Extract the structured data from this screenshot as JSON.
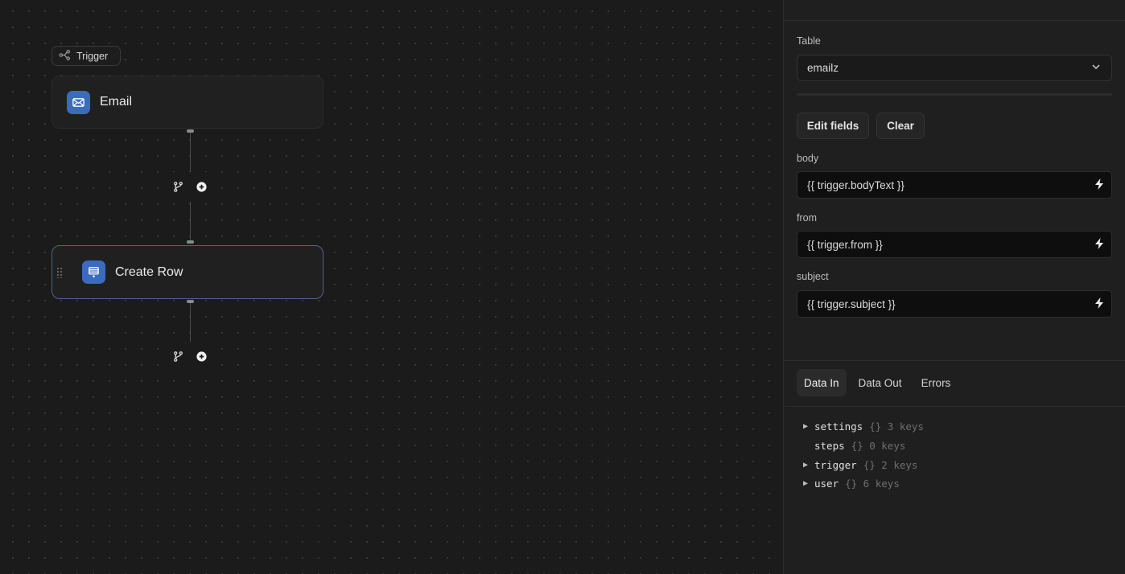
{
  "canvas": {
    "trigger_chip_label": "Trigger",
    "steps": [
      {
        "title": "Email",
        "icon": "mail-icon"
      },
      {
        "title": "Create Row",
        "icon": "table-row-icon"
      }
    ]
  },
  "panel": {
    "table_label": "Table",
    "table_value": "emailz",
    "buttons": {
      "edit_fields": "Edit fields",
      "clear": "Clear"
    },
    "fields": [
      {
        "label": "body",
        "value": "{{ trigger.bodyText }}"
      },
      {
        "label": "from",
        "value": "{{ trigger.from }}"
      },
      {
        "label": "subject",
        "value": "{{ trigger.subject }}"
      }
    ],
    "tabs": [
      "Data In",
      "Data Out",
      "Errors"
    ],
    "active_tab": "Data In",
    "tree": [
      {
        "expandable": true,
        "key": "settings",
        "meta": "{} 3 keys"
      },
      {
        "expandable": false,
        "key": "steps",
        "meta": "{} 0 keys"
      },
      {
        "expandable": true,
        "key": "trigger",
        "meta": "{} 2 keys"
      },
      {
        "expandable": true,
        "key": "user",
        "meta": "{} 6 keys"
      }
    ]
  },
  "colors": {
    "canvas_bg": "#1b1b1b",
    "panel_bg": "#1f1f1f",
    "accent_blue": "#3b6bbf",
    "selected_border": "#4a6690"
  }
}
